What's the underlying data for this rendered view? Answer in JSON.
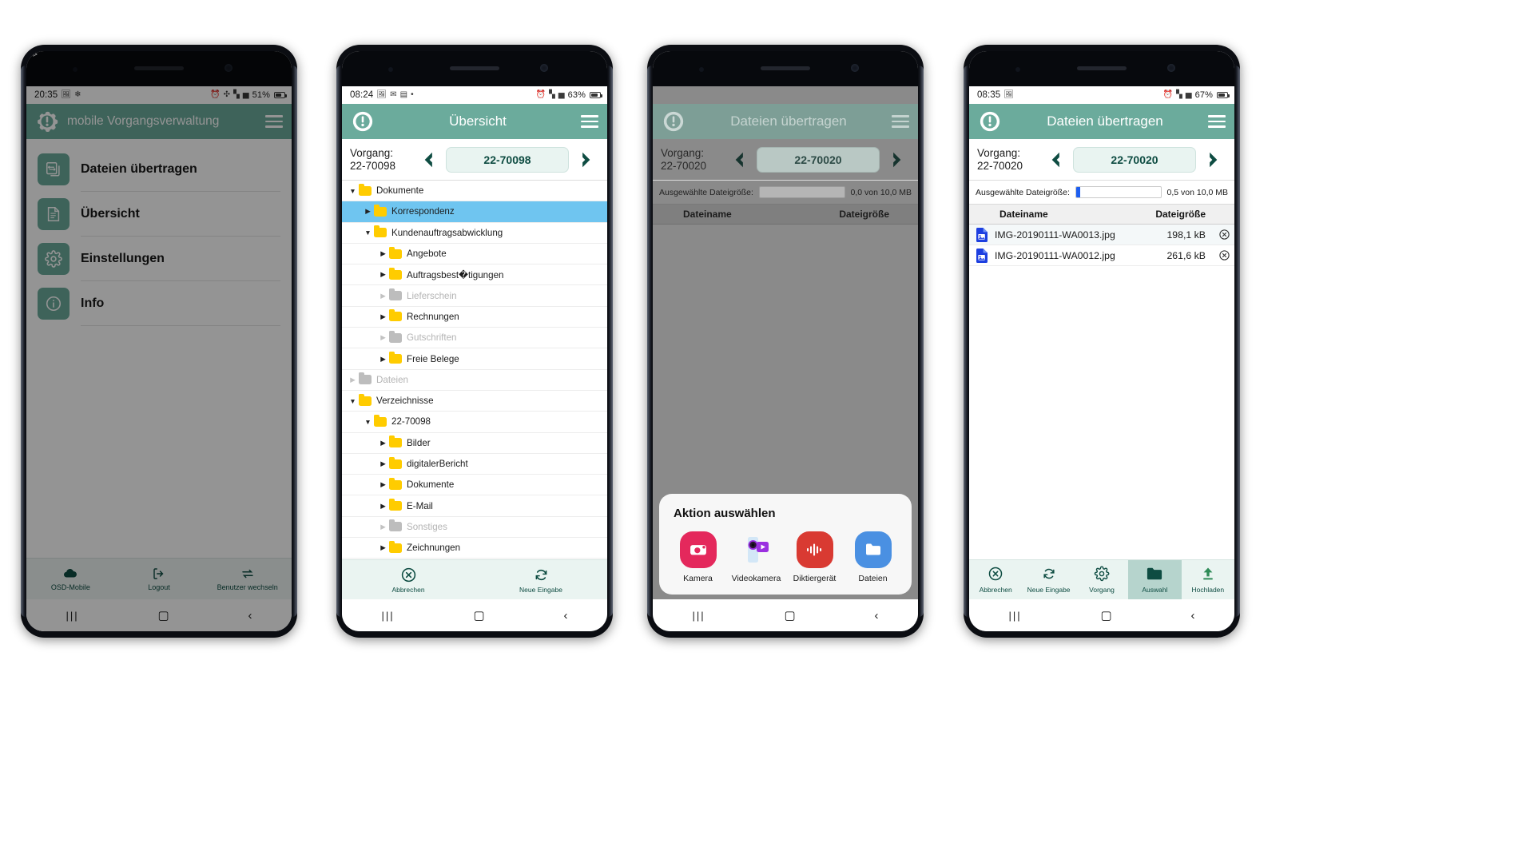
{
  "brand": {
    "teal": "#6bab9c",
    "dark_teal": "#0e4c42",
    "mint_bar": "#eaf4f1",
    "folder_yellow": "#ffcc00",
    "selection_blue": "#6fc5f0",
    "file_blue": "#1d5ef0"
  },
  "phone1": {
    "status": {
      "time": "20:35",
      "icons_left": [
        "gallery-icon",
        "snowflake-icon",
        "vibrate-icon"
      ],
      "icons_right": [
        "alarm-icon",
        "bluetooth-icon",
        "wifi-icon",
        "signal-icon"
      ],
      "battery": "51%"
    },
    "appbar": {
      "title": "mobile Vorgangsverwaltung",
      "logo": "gear-exclamation-logo",
      "menu": "hamburger-icon"
    },
    "menu_items": [
      {
        "label": "Dateien übertragen",
        "icon": "transfer-files-icon"
      },
      {
        "label": "Übersicht",
        "icon": "document-list-icon"
      },
      {
        "label": "Einstellungen",
        "icon": "gear-icon"
      },
      {
        "label": "Info",
        "icon": "info-icon"
      }
    ],
    "bottom_nav": [
      {
        "label": "OSD-Mobile",
        "icon": "cloud-icon"
      },
      {
        "label": "Logout",
        "icon": "logout-icon"
      },
      {
        "label": "Benutzer wechseln",
        "icon": "switch-user-icon"
      }
    ]
  },
  "phone2": {
    "status": {
      "time": "08:24",
      "icons_left": [
        "gallery-icon",
        "mail-icon",
        "camera-icon",
        "dot-icon"
      ],
      "icons_right": [
        "alarm-icon",
        "wifi-icon",
        "signal-icon"
      ],
      "battery": "63%"
    },
    "appbar": {
      "title": "Übersicht",
      "logo": "gear-exclamation-logo",
      "menu": "hamburger-icon"
    },
    "vorgang": {
      "label": "Vorgang: 22-70098",
      "value": "22-70098",
      "prev": "chevron-left-icon",
      "next": "chevron-right-icon"
    },
    "tree": [
      {
        "label": "Dokumente",
        "depth": 0,
        "state": "expanded",
        "disabled": false,
        "selected": false
      },
      {
        "label": "Korrespondenz",
        "depth": 1,
        "state": "collapsed",
        "disabled": false,
        "selected": true
      },
      {
        "label": "Kundenauftragsabwicklung",
        "depth": 1,
        "state": "expanded",
        "disabled": false,
        "selected": false
      },
      {
        "label": "Angebote",
        "depth": 2,
        "state": "collapsed",
        "disabled": false,
        "selected": false
      },
      {
        "label": "Auftragsbest�tigungen",
        "depth": 2,
        "state": "collapsed",
        "disabled": false,
        "selected": false
      },
      {
        "label": "Lieferschein",
        "depth": 2,
        "state": "collapsed",
        "disabled": true,
        "selected": false
      },
      {
        "label": "Rechnungen",
        "depth": 2,
        "state": "collapsed",
        "disabled": false,
        "selected": false
      },
      {
        "label": "Gutschriften",
        "depth": 2,
        "state": "collapsed",
        "disabled": true,
        "selected": false
      },
      {
        "label": "Freie Belege",
        "depth": 2,
        "state": "collapsed",
        "disabled": false,
        "selected": false
      },
      {
        "label": "Dateien",
        "depth": 0,
        "state": "collapsed",
        "disabled": true,
        "selected": false
      },
      {
        "label": "Verzeichnisse",
        "depth": 0,
        "state": "expanded",
        "disabled": false,
        "selected": false
      },
      {
        "label": "22-70098",
        "depth": 1,
        "state": "expanded",
        "disabled": false,
        "selected": false
      },
      {
        "label": "Bilder",
        "depth": 2,
        "state": "collapsed",
        "disabled": false,
        "selected": false
      },
      {
        "label": "digitalerBericht",
        "depth": 2,
        "state": "collapsed",
        "disabled": false,
        "selected": false
      },
      {
        "label": "Dokumente",
        "depth": 2,
        "state": "collapsed",
        "disabled": false,
        "selected": false
      },
      {
        "label": "E-Mail",
        "depth": 2,
        "state": "collapsed",
        "disabled": false,
        "selected": false
      },
      {
        "label": "Sonstiges",
        "depth": 2,
        "state": "collapsed",
        "disabled": true,
        "selected": false
      },
      {
        "label": "Zeichnungen",
        "depth": 2,
        "state": "collapsed",
        "disabled": false,
        "selected": false
      }
    ],
    "toolbar": [
      {
        "label": "Abbrechen",
        "icon": "cancel-circle-icon"
      },
      {
        "label": "Neue Eingabe",
        "icon": "refresh-icon"
      }
    ]
  },
  "phone3": {
    "appbar": {
      "title": "Dateien übertragen",
      "logo": "gear-exclamation-logo",
      "menu": "hamburger-icon"
    },
    "vorgang": {
      "label": "Vorgang: 22-70020",
      "value": "22-70020",
      "prev": "chevron-left-icon",
      "next": "chevron-right-icon"
    },
    "size": {
      "label": "Ausgewählte Dateigröße:",
      "amount": "0,0 von 10,0 MB",
      "fill_percent": 0
    },
    "table_headers": {
      "name": "Dateiname",
      "size": "Dateigröße"
    },
    "rows": [],
    "sheet": {
      "title": "Aktion auswählen",
      "apps": [
        {
          "label": "Kamera",
          "icon": "camera-app-icon",
          "color": "#e4285c"
        },
        {
          "label": "Videokamera",
          "icon": "video-camera-app-icon",
          "color": "#cfe4f5"
        },
        {
          "label": "Diktiergerät",
          "icon": "voice-recorder-app-icon",
          "color": "#d93a32"
        },
        {
          "label": "Dateien",
          "icon": "files-app-icon",
          "color": "#4a90e2"
        }
      ]
    }
  },
  "phone4": {
    "status": {
      "time": "08:35",
      "icons_left": [
        "gallery-icon"
      ],
      "icons_right": [
        "alarm-icon",
        "wifi-icon",
        "signal-icon"
      ],
      "battery": "67%"
    },
    "appbar": {
      "title": "Dateien übertragen",
      "logo": "gear-exclamation-logo",
      "menu": "hamburger-icon"
    },
    "vorgang": {
      "label": "Vorgang: 22-70020",
      "value": "22-70020",
      "prev": "chevron-left-icon",
      "next": "chevron-right-icon"
    },
    "size": {
      "label": "Ausgewählte Dateigröße:",
      "amount": "0,5 von 10,0 MB",
      "fill_percent": 5
    },
    "table_headers": {
      "name": "Dateiname",
      "size": "Dateigröße"
    },
    "rows": [
      {
        "name": "IMG-20190111-WA0013.jpg",
        "size": "198,1 kB",
        "icon": "image-file-icon",
        "delete": "remove-circle-icon"
      },
      {
        "name": "IMG-20190111-WA0012.jpg",
        "size": "261,6 kB",
        "icon": "image-file-icon",
        "delete": "remove-circle-icon"
      }
    ],
    "toolbar": [
      {
        "label": "Abbrechen",
        "icon": "cancel-circle-icon",
        "active": false
      },
      {
        "label": "Neue Eingabe",
        "icon": "refresh-icon",
        "active": false
      },
      {
        "label": "Vorgang",
        "icon": "gear-icon",
        "active": false
      },
      {
        "label": "Auswahl",
        "icon": "folder-icon",
        "active": true
      },
      {
        "label": "Hochladen",
        "icon": "upload-arrow-icon",
        "active": false
      }
    ]
  }
}
